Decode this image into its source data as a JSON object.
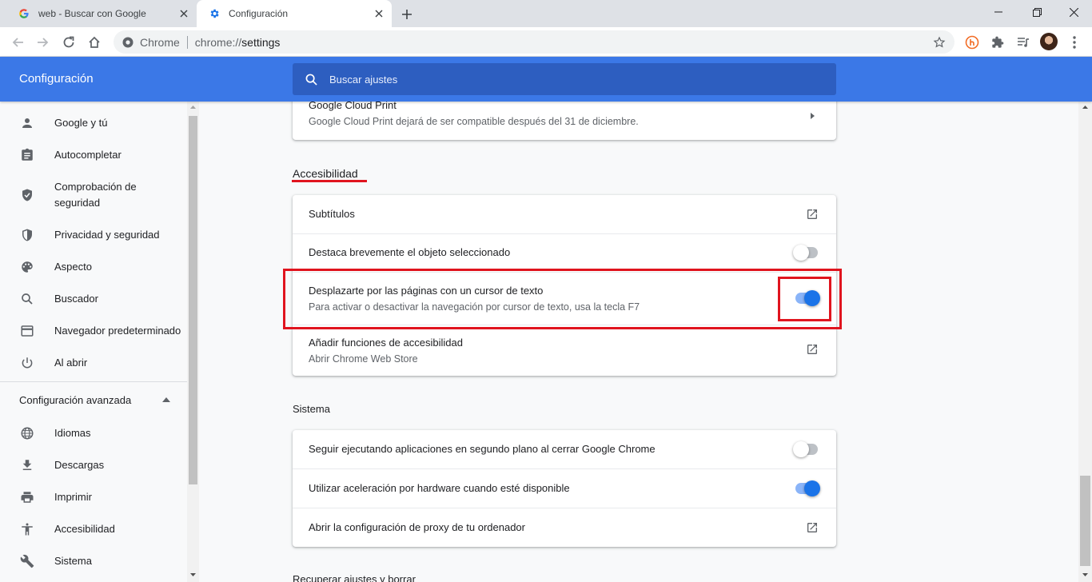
{
  "tabs": [
    {
      "title": "web - Buscar con Google",
      "icon": "google-g-icon",
      "active": false
    },
    {
      "title": "Configuración",
      "icon": "gear-icon",
      "active": true
    }
  ],
  "omnibox": {
    "chip": "Chrome",
    "scheme": "chrome://",
    "host": "settings"
  },
  "header": {
    "title": "Configuración",
    "search_placeholder": "Buscar ajustes"
  },
  "sidebar": {
    "items": [
      {
        "label": "Google y tú",
        "icon": "person-icon"
      },
      {
        "label": "Autocompletar",
        "icon": "clipboard-icon"
      },
      {
        "label": "Comprobación de seguridad",
        "icon": "shield-check-icon"
      },
      {
        "label": "Privacidad y seguridad",
        "icon": "shield-half-icon"
      },
      {
        "label": "Aspecto",
        "icon": "palette-icon"
      },
      {
        "label": "Buscador",
        "icon": "search-icon"
      },
      {
        "label": "Navegador predeterminado",
        "icon": "browser-window-icon"
      },
      {
        "label": "Al abrir",
        "icon": "power-icon"
      }
    ],
    "advanced_label": "Configuración avanzada",
    "advanced_items": [
      {
        "label": "Idiomas",
        "icon": "globe-icon"
      },
      {
        "label": "Descargas",
        "icon": "download-icon"
      },
      {
        "label": "Imprimir",
        "icon": "printer-icon"
      },
      {
        "label": "Accesibilidad",
        "icon": "accessibility-icon"
      },
      {
        "label": "Sistema",
        "icon": "wrench-icon"
      }
    ]
  },
  "printing": {
    "title": "Google Cloud Print",
    "subtitle": "Google Cloud Print dejará de ser compatible después del 31 de diciembre."
  },
  "accessibility": {
    "section_title": "Accesibilidad",
    "rows": [
      {
        "title": "Subtítulos",
        "control": "external-link"
      },
      {
        "title": "Destaca brevemente el objeto seleccionado",
        "control": "toggle",
        "on": false
      },
      {
        "title": "Desplazarte por las páginas con un cursor de texto",
        "subtitle": "Para activar o desactivar la navegación por cursor de texto, usa la tecla F7",
        "control": "toggle",
        "on": true
      },
      {
        "title": "Añadir funciones de accesibilidad",
        "subtitle": "Abrir Chrome Web Store",
        "control": "external-link"
      }
    ]
  },
  "system": {
    "section_title": "Sistema",
    "rows": [
      {
        "title": "Seguir ejecutando aplicaciones en segundo plano al cerrar Google Chrome",
        "control": "toggle",
        "on": false
      },
      {
        "title": "Utilizar aceleración por hardware cuando esté disponible",
        "control": "toggle",
        "on": true
      },
      {
        "title": "Abrir la configuración de proxy de tu ordenador",
        "control": "external-link"
      }
    ]
  },
  "reset": {
    "section_title": "Recuperar ajustes y borrar"
  },
  "colors": {
    "accent": "#1a73e8",
    "header": "#3b78e7",
    "highlight": "#e0141e"
  }
}
